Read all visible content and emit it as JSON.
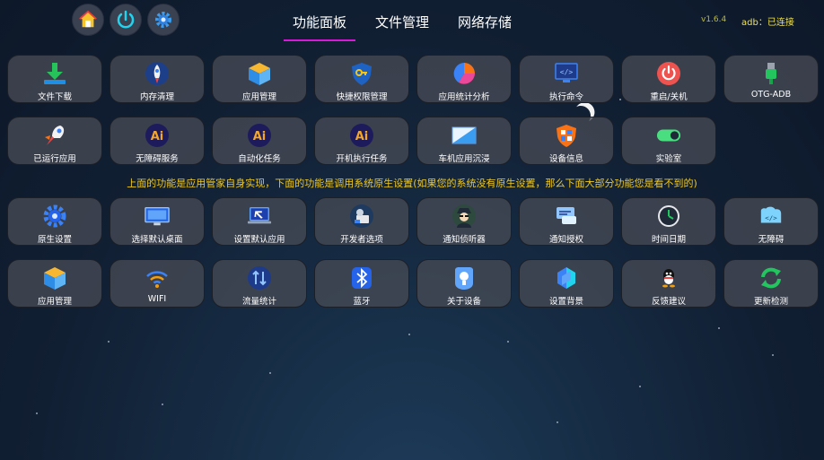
{
  "header": {
    "tabs": [
      {
        "label": "功能面板"
      },
      {
        "label": "文件管理"
      },
      {
        "label": "网络存储"
      }
    ],
    "version": "v1.6.4",
    "adb_status": "adb：已连接",
    "left_icons": [
      "home-icon",
      "power-icon",
      "gear-icon"
    ]
  },
  "notice": "上面的功能是应用管家自身实现，下面的功能是调用系统原生设置(如果您的系统没有原生设置，那么下面大部分功能您是看不到的)",
  "row1": [
    {
      "label": "文件下载",
      "icon": "download-icon"
    },
    {
      "label": "内存清理",
      "icon": "rocket-icon"
    },
    {
      "label": "应用管理",
      "icon": "box-icon"
    },
    {
      "label": "快捷权限管理",
      "icon": "shield-key-icon"
    },
    {
      "label": "应用统计分析",
      "icon": "pie-chart-icon"
    },
    {
      "label": "执行命令",
      "icon": "code-monitor-icon"
    },
    {
      "label": "重启/关机",
      "icon": "power-icon"
    },
    {
      "label": "OTG-ADB",
      "icon": "usb-icon"
    }
  ],
  "row2": [
    {
      "label": "已运行应用",
      "icon": "rocket-icon"
    },
    {
      "label": "无障碍服务",
      "icon": "ai-icon"
    },
    {
      "label": "自动化任务",
      "icon": "ai-icon"
    },
    {
      "label": "开机执行任务",
      "icon": "ai-icon"
    },
    {
      "label": "车机应用沉浸",
      "icon": "screen-icon"
    },
    {
      "label": "设备信息",
      "icon": "windows-shield-icon"
    },
    {
      "label": "实验室",
      "icon": "toggle-icon"
    }
  ],
  "row3": [
    {
      "label": "原生设置",
      "icon": "gear-icon"
    },
    {
      "label": "选择默认桌面",
      "icon": "monitor-icon"
    },
    {
      "label": "设置默认应用",
      "icon": "laptop-icon"
    },
    {
      "label": "开发者选项",
      "icon": "developer-icon"
    },
    {
      "label": "通知侦听器",
      "icon": "spy-icon"
    },
    {
      "label": "通知授权",
      "icon": "chat-icon"
    },
    {
      "label": "时间日期",
      "icon": "clock-icon"
    },
    {
      "label": "无障碍",
      "icon": "code-box-icon"
    }
  ],
  "row4": [
    {
      "label": "应用管理",
      "icon": "box-icon"
    },
    {
      "label": "WIFI",
      "icon": "wifi-icon"
    },
    {
      "label": "流量统计",
      "icon": "traffic-icon"
    },
    {
      "label": "蓝牙",
      "icon": "bluetooth-icon"
    },
    {
      "label": "关于设备",
      "icon": "about-icon"
    },
    {
      "label": "设置背景",
      "icon": "wallpaper-icon"
    },
    {
      "label": "反馈建议",
      "icon": "qq-icon"
    },
    {
      "label": "更新检测",
      "icon": "refresh-icon"
    }
  ]
}
